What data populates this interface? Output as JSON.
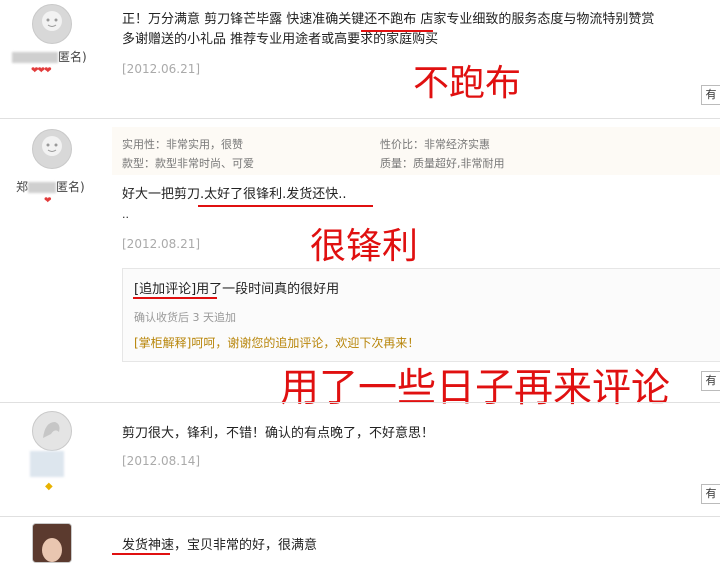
{
  "colors": {
    "annotation": "#e01010",
    "reply": "#b8860b",
    "date": "#aaaaaa",
    "heart": "#e23b3b"
  },
  "reviews": [
    {
      "user_suffix": "匿名)",
      "text_line1": "正！万分满意 剪刀锋芒毕露 快速准确关键还不跑布 店家专业细致的服务态度与物流特别赞赏",
      "text_line2": "多谢赠送的小礼品 推荐专业用途者或高要求的家庭购买",
      "date": "[2012.06.21]",
      "annotation": "不跑布",
      "help": "有",
      "badge": "❤❤❤"
    },
    {
      "user_prefix": "郑",
      "user_suffix": "匿名)",
      "attrs": [
        "实用性：非常实用，很赞",
        "性价比：非常经济实惠",
        "款型：款型非常时尚、可爱",
        "质量：质量超好,非常耐用"
      ],
      "text_line1": "好大一把剪刀.太好了很锋利.发货还快..",
      "text_line2": "..",
      "date": "[2012.08.21]",
      "annotation": "很锋利",
      "badge": "❤",
      "add_label": "[追加评论]",
      "add_text": "用了一段时间真的很好用",
      "add_meta": "确认收货后 3 天追加",
      "reply_label": "[掌柜解释]",
      "reply_text": "呵呵，谢谢您的追加评论，欢迎下次再来！",
      "annotation2": "用了一些日子再来评论",
      "help": "有"
    },
    {
      "text_line1": "剪刀很大，锋利，不错！确认的有点晚了，不好意思！",
      "date": "[2012.08.14]",
      "badge": "◆",
      "help": "有"
    },
    {
      "text_line1": "发货神速，宝贝非常的好，很满意"
    }
  ]
}
